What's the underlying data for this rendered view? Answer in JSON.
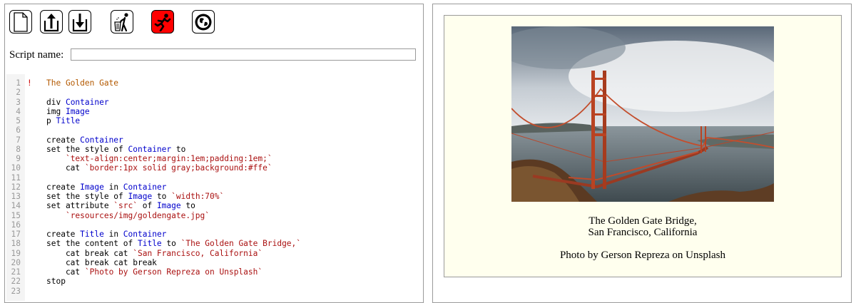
{
  "toolbar": {
    "buttons": [
      {
        "name": "new-file-icon"
      },
      {
        "name": "upload-icon"
      },
      {
        "name": "download-icon"
      },
      {
        "name": "trash-icon"
      },
      {
        "name": "run-icon",
        "color": "#ff0000"
      },
      {
        "name": "globe-icon"
      }
    ]
  },
  "script_name": {
    "label": "Script name:",
    "value": ""
  },
  "editor": {
    "lines": [
      {
        "n": "1",
        "segs": [
          {
            "t": "The Golden Gate",
            "c": "cmt"
          }
        ],
        "bang": "!"
      },
      {
        "n": "2",
        "segs": []
      },
      {
        "n": "3",
        "segs": [
          {
            "t": "div "
          },
          {
            "t": "Container",
            "c": "kw"
          }
        ]
      },
      {
        "n": "4",
        "segs": [
          {
            "t": "img "
          },
          {
            "t": "Image",
            "c": "kw"
          }
        ]
      },
      {
        "n": "5",
        "segs": [
          {
            "t": "p "
          },
          {
            "t": "Title",
            "c": "kw"
          }
        ]
      },
      {
        "n": "6",
        "segs": []
      },
      {
        "n": "7",
        "segs": [
          {
            "t": "create "
          },
          {
            "t": "Container",
            "c": "kw"
          }
        ]
      },
      {
        "n": "8",
        "segs": [
          {
            "t": "set the style of "
          },
          {
            "t": "Container",
            "c": "kw"
          },
          {
            "t": " to"
          }
        ]
      },
      {
        "n": "9",
        "segs": [
          {
            "t": "    "
          },
          {
            "t": "`text-align:center;margin:1em;padding:1em;`",
            "c": "str"
          }
        ]
      },
      {
        "n": "10",
        "segs": [
          {
            "t": "    cat "
          },
          {
            "t": "`border:1px solid gray;background:#ffe`",
            "c": "str"
          }
        ]
      },
      {
        "n": "11",
        "segs": []
      },
      {
        "n": "12",
        "segs": [
          {
            "t": "create "
          },
          {
            "t": "Image",
            "c": "kw"
          },
          {
            "t": " in "
          },
          {
            "t": "Container",
            "c": "kw"
          }
        ]
      },
      {
        "n": "13",
        "segs": [
          {
            "t": "set the style of "
          },
          {
            "t": "Image",
            "c": "kw"
          },
          {
            "t": " to "
          },
          {
            "t": "`width:70%`",
            "c": "str"
          }
        ]
      },
      {
        "n": "14",
        "segs": [
          {
            "t": "set attribute "
          },
          {
            "t": "`src`",
            "c": "str"
          },
          {
            "t": " of "
          },
          {
            "t": "Image",
            "c": "kw"
          },
          {
            "t": " to"
          }
        ]
      },
      {
        "n": "15",
        "segs": [
          {
            "t": "    "
          },
          {
            "t": "`resources/img/goldengate.jpg`",
            "c": "str"
          }
        ]
      },
      {
        "n": "16",
        "segs": []
      },
      {
        "n": "17",
        "segs": [
          {
            "t": "create "
          },
          {
            "t": "Title",
            "c": "kw"
          },
          {
            "t": " in "
          },
          {
            "t": "Container",
            "c": "kw"
          }
        ]
      },
      {
        "n": "18",
        "segs": [
          {
            "t": "set the content of "
          },
          {
            "t": "Title",
            "c": "kw"
          },
          {
            "t": " to "
          },
          {
            "t": "`The Golden Gate Bridge,`",
            "c": "str"
          }
        ]
      },
      {
        "n": "19",
        "segs": [
          {
            "t": "    cat break cat "
          },
          {
            "t": "`San Francisco, California`",
            "c": "str"
          }
        ]
      },
      {
        "n": "20",
        "segs": [
          {
            "t": "    cat break cat break"
          }
        ]
      },
      {
        "n": "21",
        "segs": [
          {
            "t": "    cat "
          },
          {
            "t": "`Photo by Gerson Repreza on Unsplash`",
            "c": "str"
          }
        ]
      },
      {
        "n": "22",
        "segs": [
          {
            "t": "stop"
          }
        ]
      },
      {
        "n": "23",
        "segs": []
      }
    ]
  },
  "preview": {
    "caption_line1": "The Golden Gate Bridge,",
    "caption_line2": "San Francisco, California",
    "credit": "Photo by Gerson Repreza on Unsplash",
    "background": "#ffffee"
  }
}
